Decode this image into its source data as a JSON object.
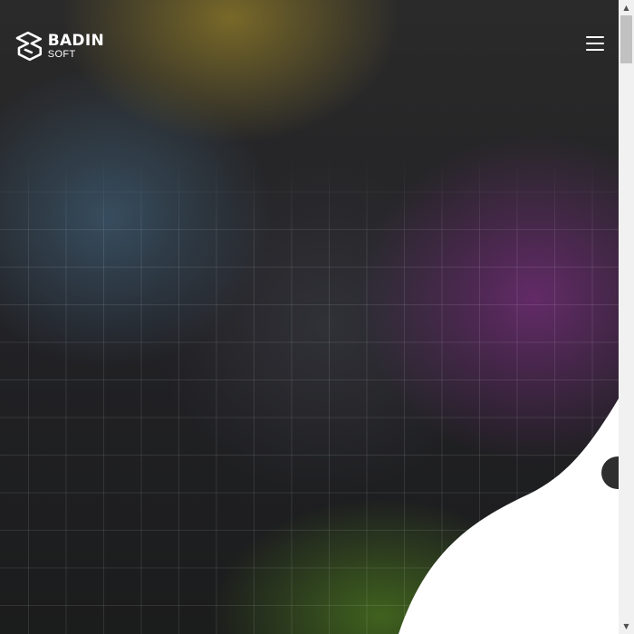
{
  "brand": {
    "name": "BADIN",
    "sub": "SOFT"
  },
  "header": {
    "menu_icon": "hamburger-menu-icon"
  },
  "hero": {
    "background_colors": [
      "#2a2a2a",
      "#8c7828",
      "#466e8c",
      "#732d78",
      "#466e1e"
    ],
    "wave_color": "#ffffff",
    "scroll_dot_icon": "scroll-dot"
  },
  "scrollbar": {
    "up_arrow": "▲",
    "down_arrow": "▼"
  }
}
